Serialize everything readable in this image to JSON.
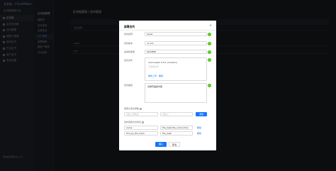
{
  "sidebar": {
    "logo_text": "长安链 · ChainMaker",
    "system_title": "区块链管理平台",
    "items": [
      {
        "label": "区块链"
      },
      {
        "label": "区块浏览器"
      },
      {
        "label": "合约管理"
      },
      {
        "label": "链账户管理"
      },
      {
        "label": "组织证书"
      },
      {
        "label": "节点证书"
      },
      {
        "label": "用户证书"
      },
      {
        "label": "系统设置"
      }
    ],
    "bottom_text": "区块链管理平台 v2.3"
  },
  "subnav": {
    "title": "区块链管理",
    "items": [
      {
        "label": "链概览"
      },
      {
        "label": "区块查询"
      },
      {
        "label": "交易查询"
      },
      {
        "label": "合约管理"
      },
      {
        "label": "投票管理"
      },
      {
        "label": "链账户管理"
      },
      {
        "label": "节点信息"
      }
    ]
  },
  "main": {
    "title": "区块链管理 / 合约管理",
    "rows": [
      "合约名称",
      "asset",
      "fact"
    ]
  },
  "modal": {
    "title": "部署合约",
    "close_symbol": "×",
    "fields": {
      "name": {
        "label": "合约名称",
        "value": "Asset"
      },
      "version": {
        "label": "合约版本",
        "value": "v1.0.0"
      },
      "vm": {
        "label": "虚拟机类型",
        "value": "WASMER"
      },
      "file": {
        "label": "合约文件",
        "file_name": "main.wasm 0.0.1 (4 wasm)",
        "placeholder": "已选择文件",
        "upload_link": "重新上传",
        "remove_link": "删除"
      },
      "desc": {
        "label": "合约描述",
        "value": "请填写描述内容"
      }
    },
    "params_section": {
      "label": "调用方法及参数",
      "key_placeholder": "请输入参数名",
      "value_placeholder": "请输入",
      "add_button": "添加"
    },
    "upgrade_section": {
      "label": "合约调用方法列表",
      "rows": [
        {
          "col1": "name",
          "col2": "file_hash,file_name,time",
          "action": "删除"
        },
        {
          "col1": "find_by_file_hash",
          "col2": "file_hash",
          "action": "删除"
        }
      ]
    },
    "footer": {
      "confirm": "确认",
      "cancel": "取消"
    },
    "check_symbol": "✓",
    "dropdown_symbol": "⌄",
    "info_symbol": "i"
  }
}
